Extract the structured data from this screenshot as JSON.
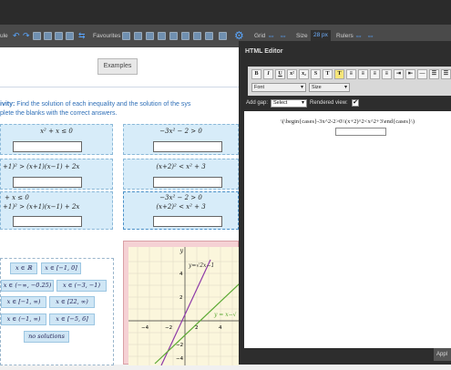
{
  "toolbar": {
    "cut_label": "ule",
    "favourites_label": "Favourites",
    "grid_label": "Grid",
    "size_label": "Size",
    "size_value": "28 px",
    "rulers_label": "Rulers"
  },
  "main": {
    "examples_label": "Examples",
    "instruction_bold": "ivity:",
    "instruction_text": " Find the solution of each inequality and the solution of the sys",
    "instruction_line2": "plete the blanks with the correct answers."
  },
  "cells": [
    {
      "math": "x² + x ≤ 0"
    },
    {
      "math": "−3x² − 2 > 0"
    },
    {
      "math": "+1)² > (x+1)(x−1) + 2x"
    },
    {
      "math": "(x+2)² < x² + 3"
    },
    {
      "math_line1": "+ x ≤ 0",
      "math_line2": "+1)² > (x+1)(x−1) + 2x"
    },
    {
      "math_line1": "−3x² − 2 > 0",
      "math_line2": "(x+2)² < x² + 3"
    }
  ],
  "answers": [
    "x ∈ ℝ",
    "x ∈ [−1, 0]",
    "x ∈ (−∞, −0.25)",
    "x ∈ (−3, −1)",
    "x ∈ [−1, ∞)",
    "x ∈ [22, ∞)",
    "x ∈ (−1, ∞)",
    "x ∈ [−5, 6]",
    "no solutions"
  ],
  "graph": {
    "x_ticks": [
      "−4",
      "−2",
      "2",
      "4"
    ],
    "y_ticks": [
      "4",
      "2",
      "−2",
      "−4"
    ],
    "label_x": "x",
    "label_y": "y",
    "eq1": "y=√2x−1",
    "eq2": "y = x−√",
    "colors": {
      "line1": "#8e3aa8",
      "line2": "#5aa832"
    }
  },
  "editor": {
    "title": "HTML Editor",
    "font_label": "Font",
    "size_label": "Size",
    "add_gap_label": "Add gap:",
    "add_gap_value": "Select",
    "rendered_label": "Rendered view:",
    "rendered_checked": "✔",
    "code": "\\(\\begin{cases}-3x^2-2>0\\\\(x+2)^2<x^2+3\\end{cases}\\)",
    "apply_label": "Appl"
  }
}
